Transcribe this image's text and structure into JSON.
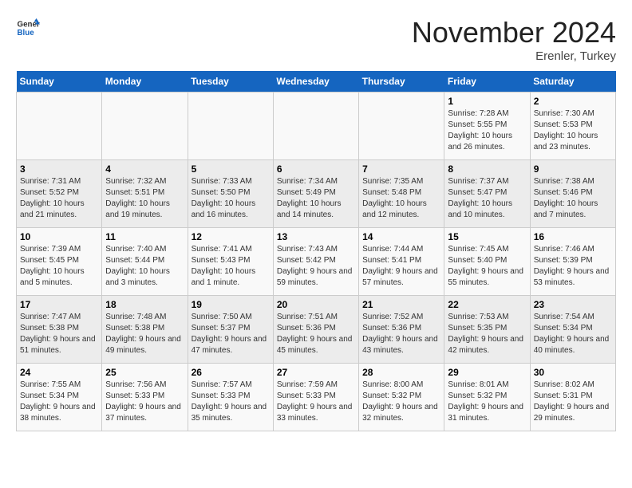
{
  "header": {
    "logo": {
      "line1": "General",
      "line2": "Blue"
    },
    "title": "November 2024",
    "subtitle": "Erenler, Turkey"
  },
  "weekdays": [
    "Sunday",
    "Monday",
    "Tuesday",
    "Wednesday",
    "Thursday",
    "Friday",
    "Saturday"
  ],
  "rows": [
    [
      {
        "day": "",
        "info": ""
      },
      {
        "day": "",
        "info": ""
      },
      {
        "day": "",
        "info": ""
      },
      {
        "day": "",
        "info": ""
      },
      {
        "day": "",
        "info": ""
      },
      {
        "day": "1",
        "info": "Sunrise: 7:28 AM\nSunset: 5:55 PM\nDaylight: 10 hours and 26 minutes."
      },
      {
        "day": "2",
        "info": "Sunrise: 7:30 AM\nSunset: 5:53 PM\nDaylight: 10 hours and 23 minutes."
      }
    ],
    [
      {
        "day": "3",
        "info": "Sunrise: 7:31 AM\nSunset: 5:52 PM\nDaylight: 10 hours and 21 minutes."
      },
      {
        "day": "4",
        "info": "Sunrise: 7:32 AM\nSunset: 5:51 PM\nDaylight: 10 hours and 19 minutes."
      },
      {
        "day": "5",
        "info": "Sunrise: 7:33 AM\nSunset: 5:50 PM\nDaylight: 10 hours and 16 minutes."
      },
      {
        "day": "6",
        "info": "Sunrise: 7:34 AM\nSunset: 5:49 PM\nDaylight: 10 hours and 14 minutes."
      },
      {
        "day": "7",
        "info": "Sunrise: 7:35 AM\nSunset: 5:48 PM\nDaylight: 10 hours and 12 minutes."
      },
      {
        "day": "8",
        "info": "Sunrise: 7:37 AM\nSunset: 5:47 PM\nDaylight: 10 hours and 10 minutes."
      },
      {
        "day": "9",
        "info": "Sunrise: 7:38 AM\nSunset: 5:46 PM\nDaylight: 10 hours and 7 minutes."
      }
    ],
    [
      {
        "day": "10",
        "info": "Sunrise: 7:39 AM\nSunset: 5:45 PM\nDaylight: 10 hours and 5 minutes."
      },
      {
        "day": "11",
        "info": "Sunrise: 7:40 AM\nSunset: 5:44 PM\nDaylight: 10 hours and 3 minutes."
      },
      {
        "day": "12",
        "info": "Sunrise: 7:41 AM\nSunset: 5:43 PM\nDaylight: 10 hours and 1 minute."
      },
      {
        "day": "13",
        "info": "Sunrise: 7:43 AM\nSunset: 5:42 PM\nDaylight: 9 hours and 59 minutes."
      },
      {
        "day": "14",
        "info": "Sunrise: 7:44 AM\nSunset: 5:41 PM\nDaylight: 9 hours and 57 minutes."
      },
      {
        "day": "15",
        "info": "Sunrise: 7:45 AM\nSunset: 5:40 PM\nDaylight: 9 hours and 55 minutes."
      },
      {
        "day": "16",
        "info": "Sunrise: 7:46 AM\nSunset: 5:39 PM\nDaylight: 9 hours and 53 minutes."
      }
    ],
    [
      {
        "day": "17",
        "info": "Sunrise: 7:47 AM\nSunset: 5:38 PM\nDaylight: 9 hours and 51 minutes."
      },
      {
        "day": "18",
        "info": "Sunrise: 7:48 AM\nSunset: 5:38 PM\nDaylight: 9 hours and 49 minutes."
      },
      {
        "day": "19",
        "info": "Sunrise: 7:50 AM\nSunset: 5:37 PM\nDaylight: 9 hours and 47 minutes."
      },
      {
        "day": "20",
        "info": "Sunrise: 7:51 AM\nSunset: 5:36 PM\nDaylight: 9 hours and 45 minutes."
      },
      {
        "day": "21",
        "info": "Sunrise: 7:52 AM\nSunset: 5:36 PM\nDaylight: 9 hours and 43 minutes."
      },
      {
        "day": "22",
        "info": "Sunrise: 7:53 AM\nSunset: 5:35 PM\nDaylight: 9 hours and 42 minutes."
      },
      {
        "day": "23",
        "info": "Sunrise: 7:54 AM\nSunset: 5:34 PM\nDaylight: 9 hours and 40 minutes."
      }
    ],
    [
      {
        "day": "24",
        "info": "Sunrise: 7:55 AM\nSunset: 5:34 PM\nDaylight: 9 hours and 38 minutes."
      },
      {
        "day": "25",
        "info": "Sunrise: 7:56 AM\nSunset: 5:33 PM\nDaylight: 9 hours and 37 minutes."
      },
      {
        "day": "26",
        "info": "Sunrise: 7:57 AM\nSunset: 5:33 PM\nDaylight: 9 hours and 35 minutes."
      },
      {
        "day": "27",
        "info": "Sunrise: 7:59 AM\nSunset: 5:33 PM\nDaylight: 9 hours and 33 minutes."
      },
      {
        "day": "28",
        "info": "Sunrise: 8:00 AM\nSunset: 5:32 PM\nDaylight: 9 hours and 32 minutes."
      },
      {
        "day": "29",
        "info": "Sunrise: 8:01 AM\nSunset: 5:32 PM\nDaylight: 9 hours and 31 minutes."
      },
      {
        "day": "30",
        "info": "Sunrise: 8:02 AM\nSunset: 5:31 PM\nDaylight: 9 hours and 29 minutes."
      }
    ]
  ]
}
